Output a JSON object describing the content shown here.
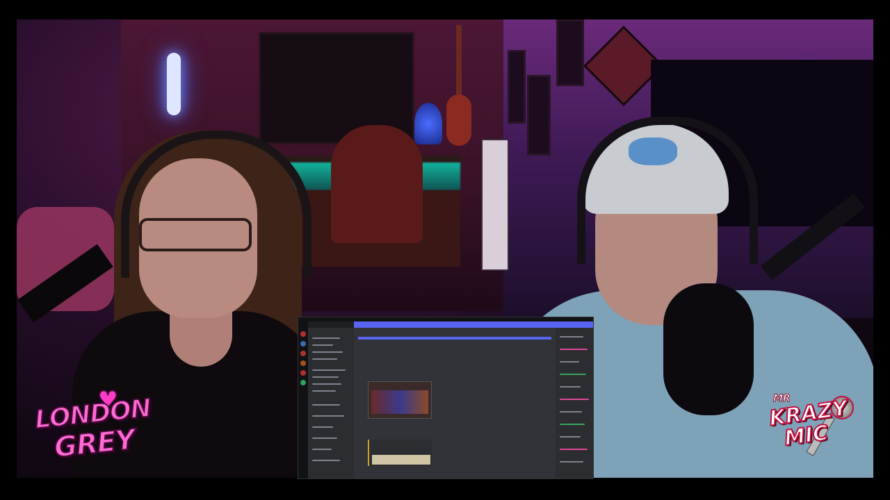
{
  "scene": {
    "description_kind": "stream-webcam-composite",
    "overlay_logos": {
      "left": {
        "line1": "LONDON",
        "line2": "GREY",
        "color": "#ff6ad5"
      },
      "right": {
        "line1": "MR",
        "line2": "KRAZY",
        "line3": "MIC",
        "color": "#c01040"
      }
    }
  },
  "colors": {
    "neon_blue": "#4a6cff",
    "teal_bar": "#0bd1b0",
    "wall_purple": "#6a2a7a",
    "discord_accent": "#5865f2"
  }
}
